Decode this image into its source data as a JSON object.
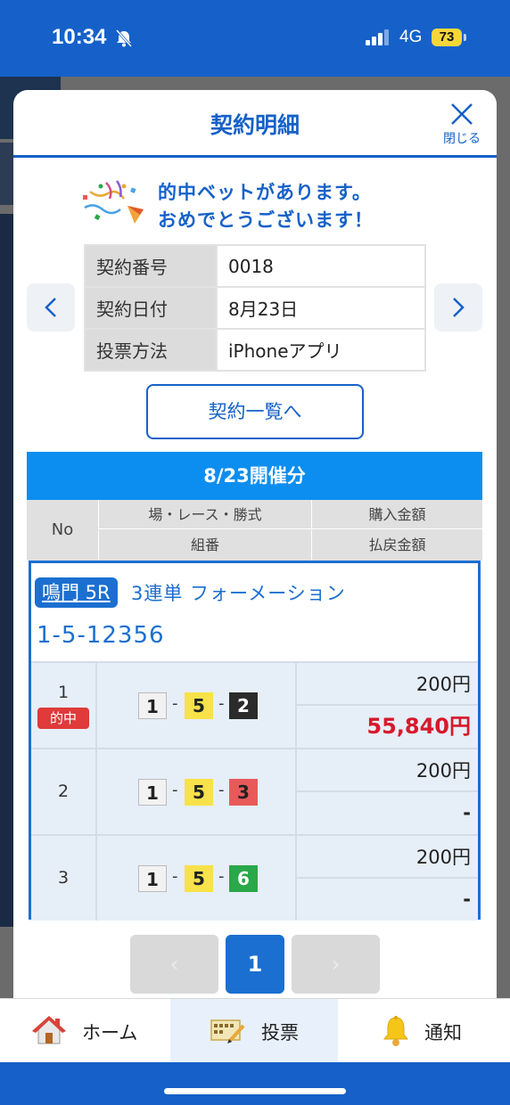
{
  "status_bar": {
    "time": "10:34",
    "network": "4G",
    "battery": "73"
  },
  "modal": {
    "title": "契約明細",
    "close_label": "閉じる",
    "congrats_line1": "的中ベットがあります。",
    "congrats_line2": "おめでとうございます！",
    "info": [
      {
        "key": "契約番号",
        "value": "0018"
      },
      {
        "key": "契約日付",
        "value": "8月23日"
      },
      {
        "key": "投票方法",
        "value": "iPhoneアプリ"
      }
    ],
    "list_button": "契約一覧へ",
    "date_header": "8/23開催分",
    "columns": {
      "no": "No",
      "race": "場・レース・勝式",
      "purchase": "購入金額",
      "combo": "組番",
      "payout": "払戻金額"
    },
    "bet": {
      "race": "鳴門 5R",
      "type": "3連単 フォーメーション",
      "combination": "1-5-12356",
      "rows": [
        {
          "no": "1",
          "hit": "的中",
          "n1": "1",
          "n2": "5",
          "n3": "2",
          "n3_color": "#2b2b2b",
          "n3_text_color": "#ffffff",
          "purchase": "200円",
          "payout": "55,840円"
        },
        {
          "no": "2",
          "n1": "1",
          "n2": "5",
          "n3": "3",
          "n3_color": "#e85a5a",
          "n3_text_color": "#222222",
          "purchase": "200円",
          "payout": "-"
        },
        {
          "no": "3",
          "n1": "1",
          "n2": "5",
          "n3": "6",
          "n3_color": "#2aa84a",
          "n3_text_color": "#ffffff",
          "purchase": "200円",
          "payout": "-"
        }
      ]
    },
    "pager": {
      "prev": "‹",
      "current": "1",
      "next": "›"
    }
  },
  "bottom_nav": {
    "home": "ホーム",
    "vote": "投票",
    "notify": "通知"
  },
  "colors": {
    "brand_blue": "#1561c9",
    "win_red": "#d7192b"
  }
}
